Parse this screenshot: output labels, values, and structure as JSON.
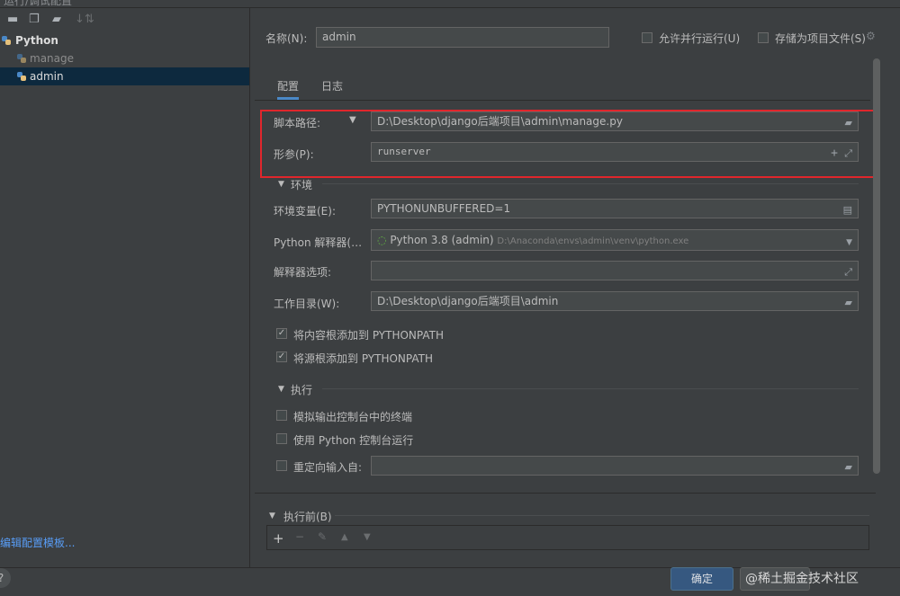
{
  "window": {
    "title": "运行/调试配置"
  },
  "toolbar": {
    "icons": [
      "minus-icon",
      "copy-icon",
      "folder-add-icon",
      "sort-icon"
    ]
  },
  "tree": {
    "group": "Python",
    "items": [
      {
        "label": "manage"
      },
      {
        "label": "admin",
        "selected": true
      }
    ]
  },
  "sidebar": {
    "link": "编辑配置模板..."
  },
  "header": {
    "name_label": "名称(N):",
    "name_value": "admin",
    "parallel_label": "允许并行运行(U)",
    "store_label": "存储为项目文件(S)"
  },
  "tabs": [
    {
      "label": "配置"
    },
    {
      "label": "日志"
    }
  ],
  "script": {
    "type_label": "脚本路径:",
    "value": "D:\\Desktop\\django后端项目\\admin\\manage.py",
    "params_label": "形参(P):",
    "params_value": "runserver"
  },
  "env": {
    "section_label": "环境",
    "vars_label": "环境变量(E):",
    "vars_value": "PYTHONUNBUFFERED=1",
    "interpreter_label": "Python 解释器(…",
    "interpreter_value": "Python 3.8 (admin)",
    "interpreter_path": "D:\\Anaconda\\envs\\admin\\venv\\python.exe",
    "options_label": "解释器选项:",
    "options_value": "",
    "workdir_label": "工作目录(W):",
    "workdir_value": "D:\\Desktop\\django后端项目\\admin",
    "content_roots_label": "将内容根添加到 PYTHONPATH",
    "source_roots_label": "将源根添加到 PYTHONPATH"
  },
  "exec": {
    "section_label": "执行",
    "emulate_label": "模拟输出控制台中的终端",
    "console_label": "使用 Python 控制台运行",
    "redirect_label": "重定向输入自:",
    "redirect_value": ""
  },
  "before": {
    "section_label": "执行前(B)"
  },
  "footer": {
    "ok_label": "确定",
    "watermark": "@稀土掘金技术社区"
  },
  "colors": {
    "accent": "#4a88c7",
    "highlight": "#e0262c",
    "selection": "#0d293e",
    "background": "#3c3f41"
  }
}
